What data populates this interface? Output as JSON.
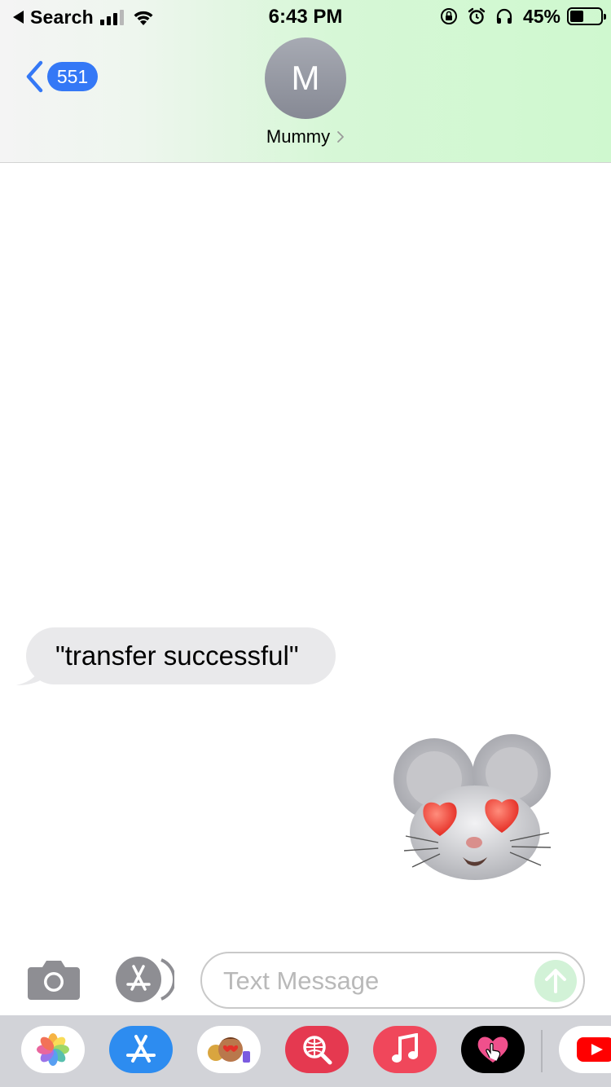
{
  "status_bar": {
    "back_app_label": "Search",
    "time": "6:43 PM",
    "battery_percent": "45%",
    "battery_level": 0.45,
    "icons": [
      "signal-icon",
      "wifi-icon",
      "orientation-lock-icon",
      "alarm-icon",
      "headphones-icon",
      "battery-icon"
    ]
  },
  "nav": {
    "back_count": "551",
    "contact_initial": "M",
    "contact_name": "Mummy"
  },
  "messages": [
    {
      "direction": "incoming",
      "type": "text",
      "text": "\"transfer successful\""
    },
    {
      "direction": "outgoing",
      "type": "sticker",
      "sticker": "mouse-memoji-heart-eyes"
    }
  ],
  "composer": {
    "placeholder": "Text Message",
    "value": ""
  },
  "app_drawer": {
    "apps": [
      "photos",
      "app-store",
      "memoji-stickers",
      "images-search",
      "music",
      "digital-touch",
      "youtube"
    ]
  },
  "colors": {
    "accent_blue": "#3478f6",
    "bubble_gray": "#e9e9eb",
    "header_green": "#cff8cf",
    "send_button": "#d2f2d7"
  }
}
